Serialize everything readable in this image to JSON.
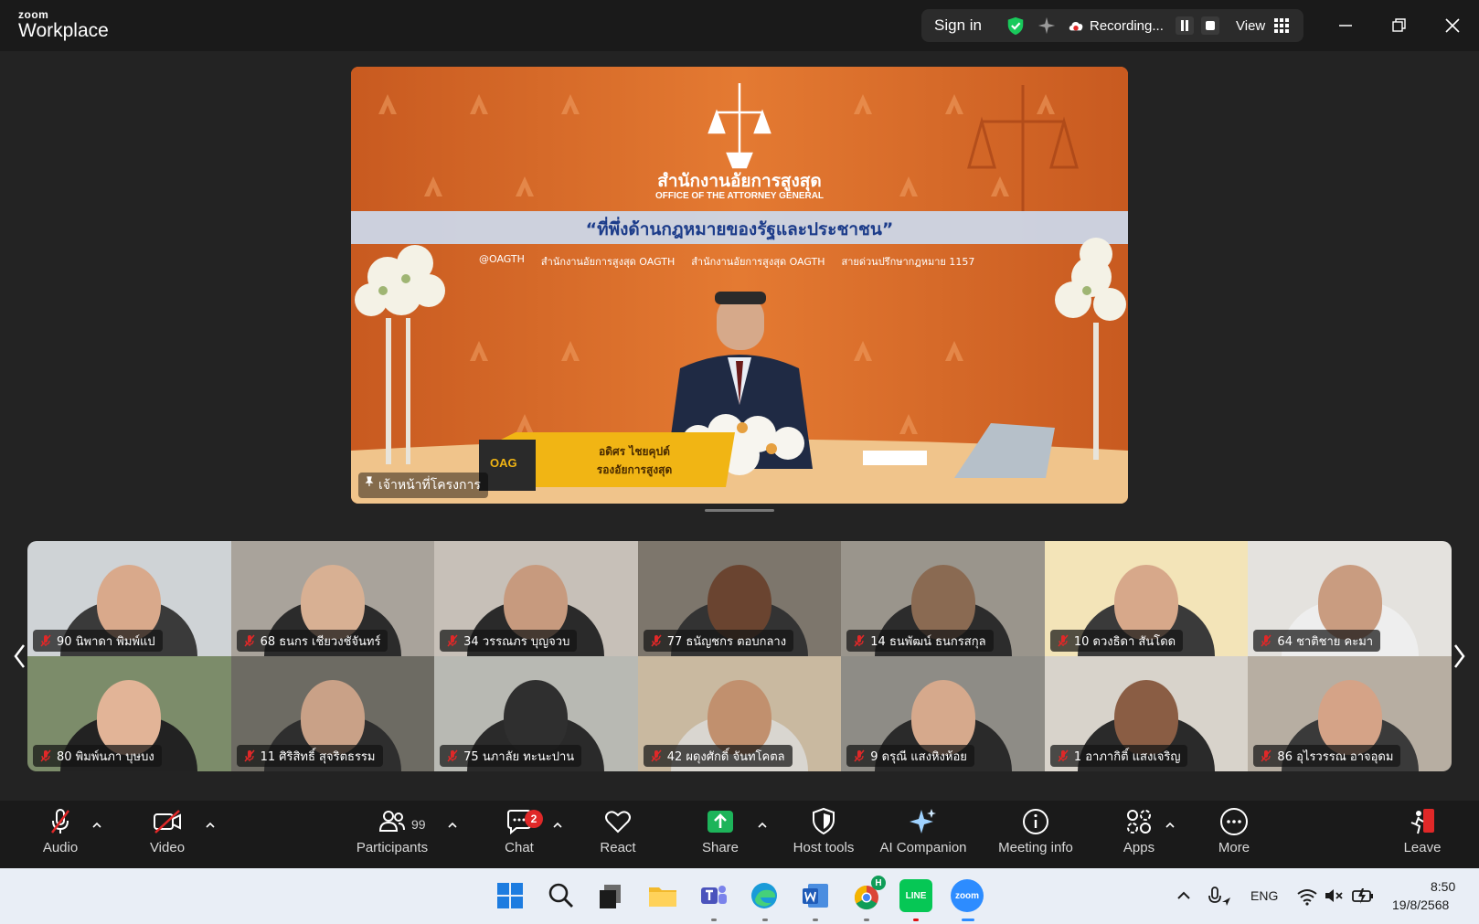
{
  "app": {
    "brand_small": "zoom",
    "brand_big": "Workplace"
  },
  "topbar": {
    "sign_in": "Sign in",
    "recording": "Recording...",
    "view": "View"
  },
  "speaker": {
    "name": "เจ้าหน้าที่โครงการ",
    "org_th": "สำนักงานอัยการสูงสุด",
    "org_en": "OFFICE OF THE ATTORNEY GENERAL",
    "slogan": "“ที่พึ่งด้านกฎหมายของรัฐและประชาชน”",
    "social": [
      "@OAGTH",
      "สำนักงานอัยการสูงสุด OAGTH",
      "สำนักงานอัยการสูงสุด OAGTH",
      "สายด่วนปรึกษากฎหมาย 1157"
    ],
    "nameplate_name": "อดิศร ไชยคุปต์",
    "nameplate_title": "รองอัยการสูงสุด",
    "nameplate_logo": "OAG"
  },
  "participants": [
    {
      "label": "90 นิพาดา พิมพ์แป",
      "bg": "#cfd3d6",
      "skin": "#d9a98b",
      "shirt": "#3a3a3a"
    },
    {
      "label": "68 ธนกร เชียวงชัจันทร์",
      "bg": "#a9a39b",
      "skin": "#d8b093",
      "shirt": "#2b2b2b"
    },
    {
      "label": "34 วรรณภร บุญจวบ",
      "bg": "#c7c0b8",
      "skin": "#c79a7e",
      "shirt": "#2a2a2a"
    },
    {
      "label": "77 ธนัญชกร ตอบกลาง",
      "bg": "#7d766c",
      "skin": "#6a4430",
      "shirt": "#333333"
    },
    {
      "label": "14 ธนพัฒน์ ธนกรสกุล",
      "bg": "#9a958c",
      "skin": "#8a6a52",
      "shirt": "#2c2c2c"
    },
    {
      "label": "10 ดวงธิดา สันโดด",
      "bg": "#f3e4b8",
      "skin": "#d7a88a",
      "shirt": "#3a3a3a"
    },
    {
      "label": "64 ชาติชาย คะมา",
      "bg": "#e4e2de",
      "skin": "#c99c80",
      "shirt": "#eeeeee"
    },
    {
      "label": "80 พิมพ์นภา บุษบง",
      "bg": "#7c8c6a",
      "skin": "#e2b497",
      "shirt": "#222222"
    },
    {
      "label": "11 ศิริสิทธิ์ สุจริตธรรม",
      "bg": "#6d6b63",
      "skin": "#c9a187",
      "shirt": "#2e2e2e"
    },
    {
      "label": "75 นภาลัย ทะนะปาน",
      "bg": "#b8b9b3",
      "skin": "#2f2f2f",
      "shirt": "#2a2a2a"
    },
    {
      "label": "42 ผดุงศักดิ์ จันทโคตล",
      "bg": "#c9b9a0",
      "skin": "#c1906e",
      "shirt": "#d9d6d0"
    },
    {
      "label": "9 ดรุณี แสงหิงห้อย",
      "bg": "#8e8c86",
      "skin": "#d6a98c",
      "shirt": "#2a2a2a"
    },
    {
      "label": "1 อาภากิติ์ แสงเจริญ",
      "bg": "#d8d3cb",
      "skin": "#8a5d44",
      "shirt": "#2a2a2a"
    },
    {
      "label": "86 อุไรวรรณ อาจอุดม",
      "bg": "#b7aea2",
      "skin": "#d5a387",
      "shirt": "#3a3a3a"
    }
  ],
  "toolbar": {
    "audio": "Audio",
    "video": "Video",
    "participants": "Participants",
    "participants_count": "99",
    "chat": "Chat",
    "chat_badge": "2",
    "react": "React",
    "share": "Share",
    "host_tools": "Host tools",
    "ai_companion": "AI Companion",
    "meeting_info": "Meeting info",
    "apps": "Apps",
    "more": "More",
    "leave": "Leave"
  },
  "taskbar": {
    "lang": "ENG",
    "time": "8:50",
    "date": "19/8/2568",
    "chrome_badge": "H",
    "zoom_label": "zoom",
    "line_label": "LINE"
  },
  "colors": {
    "accent_green": "#19c95b",
    "record_red": "#e02828",
    "share_green": "#1db45a",
    "leave_red": "#e02828"
  }
}
